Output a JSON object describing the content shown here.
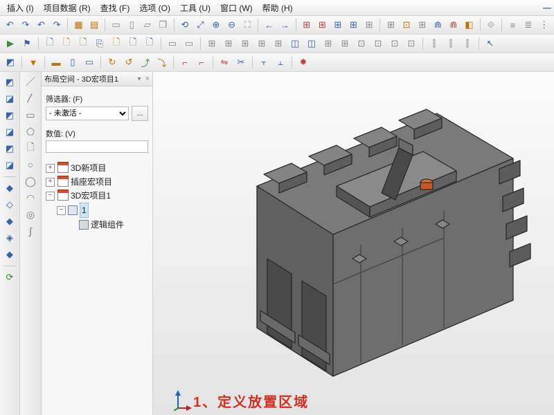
{
  "menu": {
    "items": [
      "插入 (I)",
      "项目数据 (R)",
      "查找 (F)",
      "选项 (O)",
      "工具 (U)",
      "窗口 (W)",
      "帮助 (H)"
    ]
  },
  "panel": {
    "title": "布局空间 - 3D宏项目1",
    "filter_label": "筛选器: (F)",
    "filter_value": "- 未激活 -",
    "dots": "...",
    "value_label": "数值: (V)",
    "value": ""
  },
  "tree": {
    "n1": "3D新项目",
    "n2": "插座宏项目",
    "n3": "3D宏项目1",
    "n3a": "1",
    "n3b": "逻辑组件"
  },
  "annotation": "1、定义放置区域",
  "colors": {
    "accent": "#3a62a8",
    "anno": "#d03020",
    "model": "#707070"
  }
}
